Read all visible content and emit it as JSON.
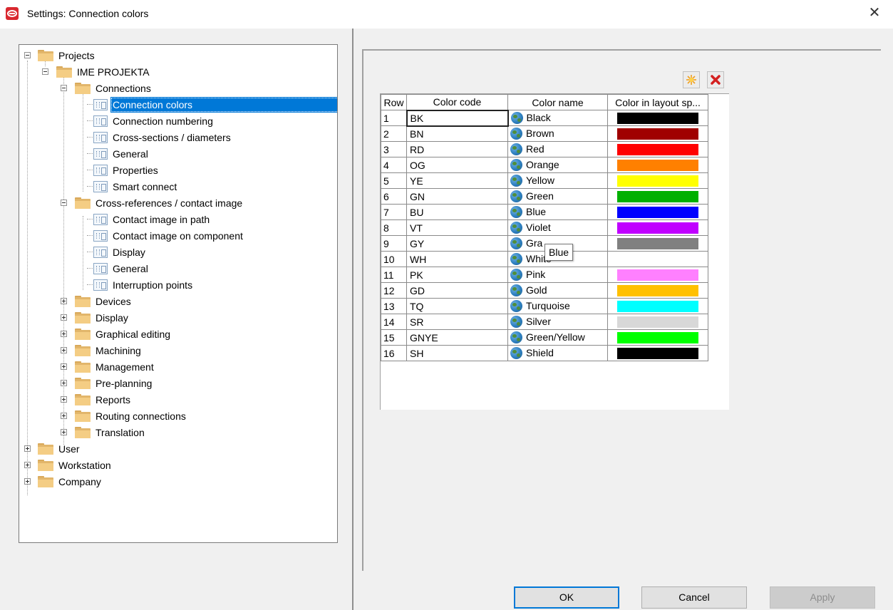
{
  "window": {
    "title": "Settings: Connection colors",
    "close_glyph": "✕"
  },
  "search": {
    "value": "",
    "placeholder": ""
  },
  "toolbar_left": {
    "icons": [
      "clear-filter-icon",
      "expand-icon",
      "collapse-icon"
    ]
  },
  "tree": {
    "projects": "Projects",
    "project_name": "IME PROJEKTA",
    "connections": "Connections",
    "connection_colors": "Connection colors",
    "connection_numbering": "Connection numbering",
    "cross_sections": "Cross-sections / diameters",
    "general1": "General",
    "properties": "Properties",
    "smart_connect": "Smart connect",
    "cross_references": "Cross-references / contact image",
    "contact_image_path": "Contact image in path",
    "contact_image_component": "Contact image on component",
    "display1": "Display",
    "general2": "General",
    "interruption_points": "Interruption points",
    "devices": "Devices",
    "display2": "Display",
    "graphical_editing": "Graphical editing",
    "machining": "Machining",
    "management": "Management",
    "pre_planning": "Pre-planning",
    "reports": "Reports",
    "routing_connections": "Routing connections",
    "translation": "Translation",
    "user": "User",
    "workstation": "Workstation",
    "company": "Company"
  },
  "grid": {
    "headers": [
      "Row",
      "Color code",
      "Color name",
      "Color in layout sp..."
    ],
    "rows": [
      {
        "row": "1",
        "code": "BK",
        "name": "Black",
        "color": "#000000"
      },
      {
        "row": "2",
        "code": "BN",
        "name": "Brown",
        "color": "#a00000"
      },
      {
        "row": "3",
        "code": "RD",
        "name": "Red",
        "color": "#ff0000"
      },
      {
        "row": "4",
        "code": "OG",
        "name": "Orange",
        "color": "#ff8000"
      },
      {
        "row": "5",
        "code": "YE",
        "name": "Yellow",
        "color": "#ffff00"
      },
      {
        "row": "6",
        "code": "GN",
        "name": "Green",
        "color": "#00b000"
      },
      {
        "row": "7",
        "code": "BU",
        "name": "Blue",
        "color": "#0000ff"
      },
      {
        "row": "8",
        "code": "VT",
        "name": "Violet",
        "color": "#c000ff"
      },
      {
        "row": "9",
        "code": "GY",
        "name": "Gra",
        "color": "#808080"
      },
      {
        "row": "10",
        "code": "WH",
        "name": "White",
        "color": ""
      },
      {
        "row": "11",
        "code": "PK",
        "name": "Pink",
        "color": "#ff80ff"
      },
      {
        "row": "12",
        "code": "GD",
        "name": "Gold",
        "color": "#ffc000"
      },
      {
        "row": "13",
        "code": "TQ",
        "name": "Turquoise",
        "color": "#00ffff"
      },
      {
        "row": "14",
        "code": "SR",
        "name": "Silver",
        "color": "#d8d8d8"
      },
      {
        "row": "15",
        "code": "GNYE",
        "name": "Green/Yellow",
        "color": "#00ff00"
      },
      {
        "row": "16",
        "code": "SH",
        "name": "Shield",
        "color": "#000000"
      }
    ]
  },
  "tooltip": {
    "text": "Blue"
  },
  "buttons": {
    "ok": "OK",
    "cancel": "Cancel",
    "apply": "Apply"
  }
}
